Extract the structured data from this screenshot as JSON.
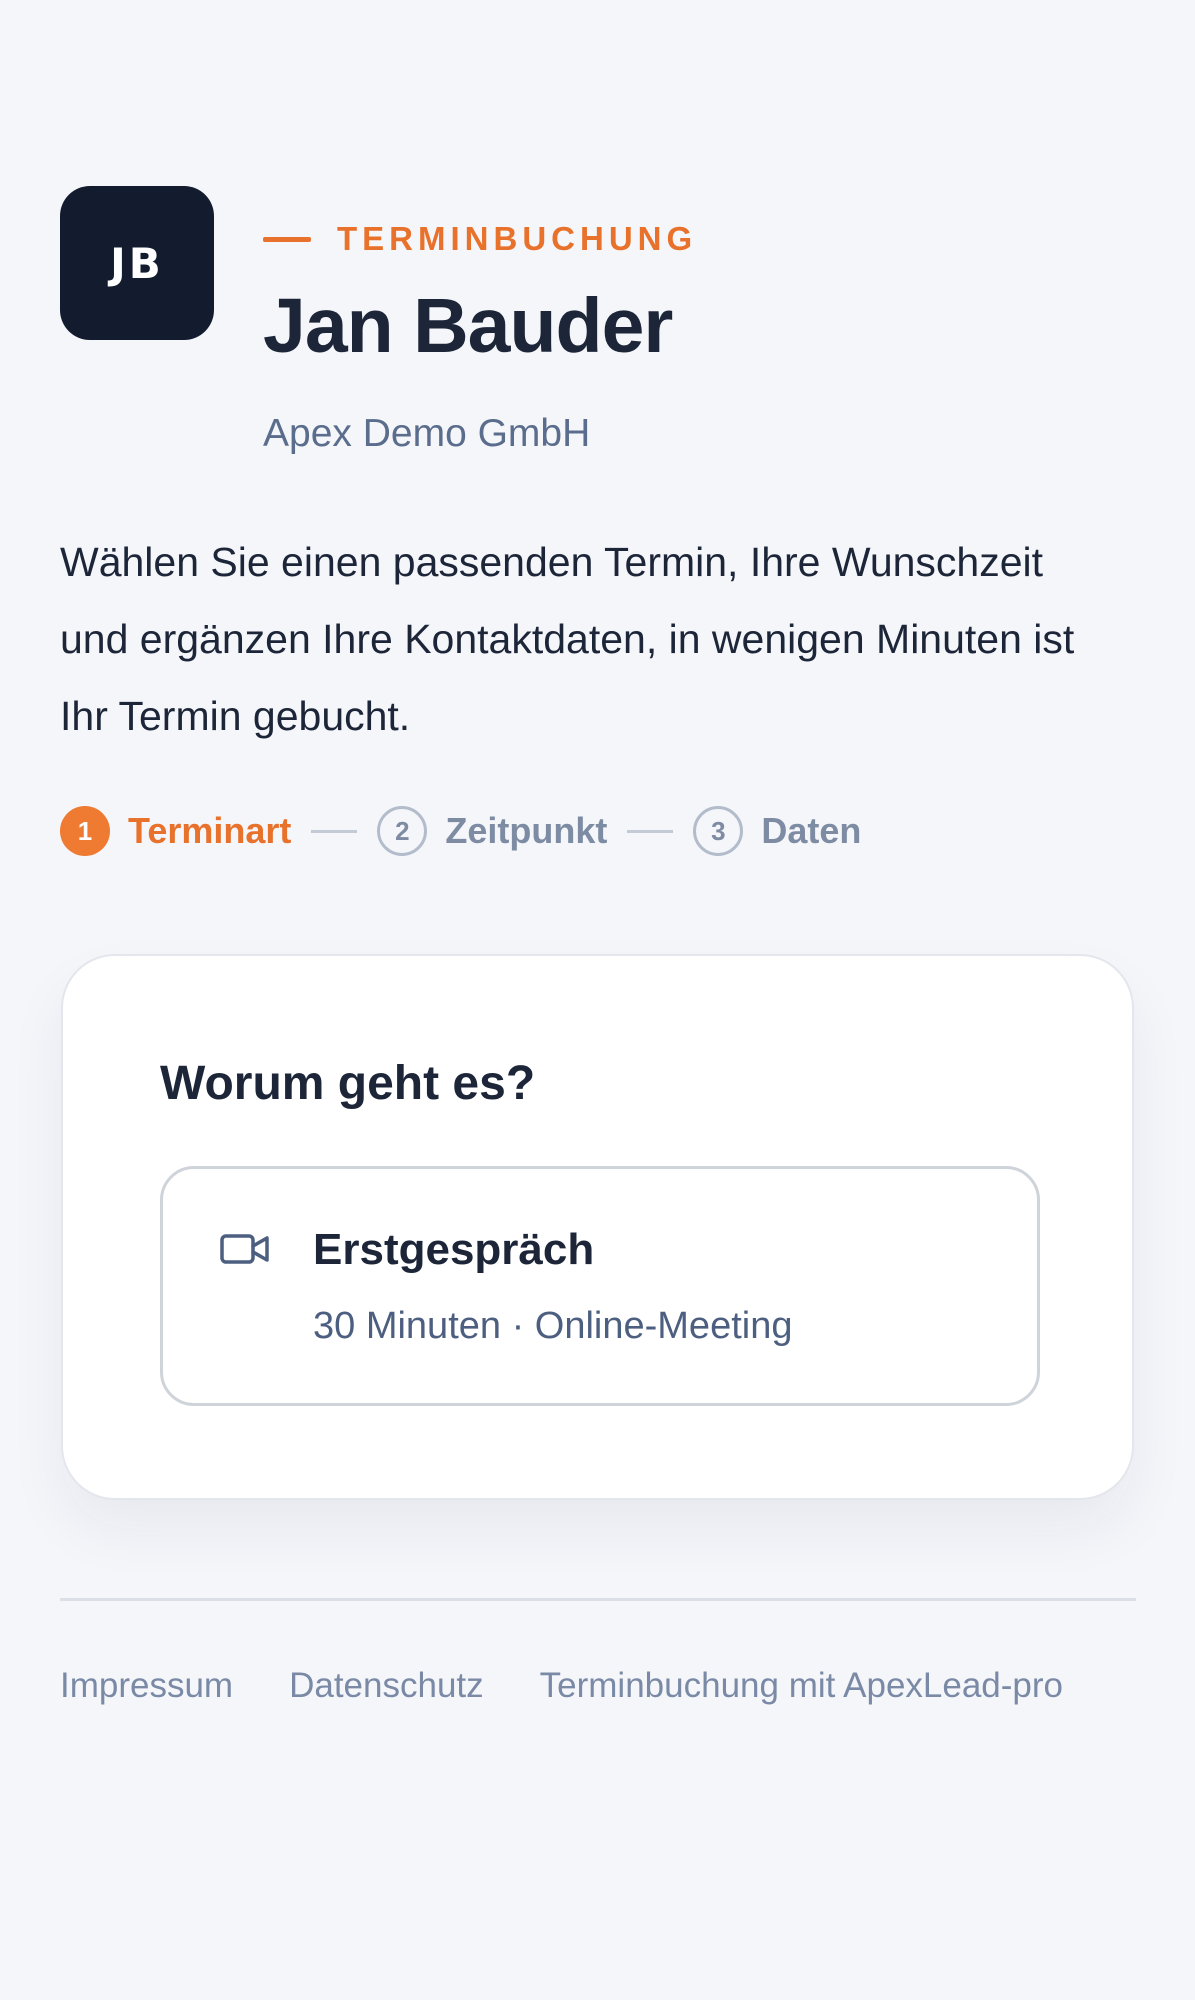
{
  "profile": {
    "initials": "JB",
    "eyebrow": "TERMINBUCHUNG",
    "name": "Jan Bauder",
    "company": "Apex Demo GmbH"
  },
  "intro": "Wählen Sie einen passenden Termin, Ihre Wunschzeit und ergänzen Ihre Kontaktdaten, in wenigen Minuten ist Ihr Termin gebucht.",
  "steps": [
    {
      "number": "1",
      "label": "Terminart",
      "active": true
    },
    {
      "number": "2",
      "label": "Zeitpunkt",
      "active": false
    },
    {
      "number": "3",
      "label": "Daten",
      "active": false
    }
  ],
  "card": {
    "title": "Worum geht es?",
    "options": [
      {
        "icon": "video-camera-icon",
        "title": "Erstgespräch",
        "meta": "30 Minuten · Online-Meeting"
      }
    ]
  },
  "footer": {
    "links": [
      "Impressum",
      "Datenschutz",
      "Terminbuchung mit ApexLead-pro"
    ]
  },
  "colors": {
    "accent": "#e8712b",
    "dark": "#131c2e",
    "background": "#f5f6fa"
  }
}
